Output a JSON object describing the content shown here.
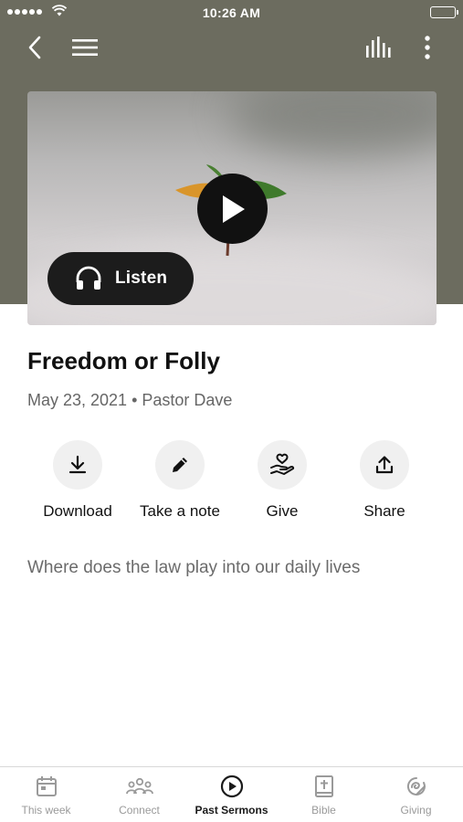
{
  "status_bar": {
    "time": "10:26 AM"
  },
  "top_nav": {
    "icons": [
      "back-icon",
      "menu-icon",
      "audio-levels-icon",
      "more-options-icon"
    ]
  },
  "hero": {
    "listen_label": "Listen",
    "icons": [
      "play-icon",
      "headphones-icon"
    ]
  },
  "sermon": {
    "title": "Freedom or Folly",
    "meta": "May 23, 2021 • Pastor Dave",
    "description": "Where does the law play into our daily lives"
  },
  "actions": [
    {
      "label": "Download",
      "icon": "download-icon"
    },
    {
      "label": "Take a note",
      "icon": "pencil-icon"
    },
    {
      "label": "Give",
      "icon": "give-hand-heart-icon"
    },
    {
      "label": "Share",
      "icon": "share-icon"
    }
  ],
  "tabs": [
    {
      "label": "This week",
      "icon": "calendar-icon",
      "active": false
    },
    {
      "label": "Connect",
      "icon": "people-icon",
      "active": false
    },
    {
      "label": "Past Sermons",
      "icon": "play-circle-icon",
      "active": true
    },
    {
      "label": "Bible",
      "icon": "bible-icon",
      "active": false
    },
    {
      "label": "Giving",
      "icon": "giving-icon",
      "active": false
    }
  ],
  "colors": {
    "header_bg": "#6c6c5f",
    "active_tab": "#1a1a1a",
    "inactive_tab": "#9a9a9a"
  }
}
